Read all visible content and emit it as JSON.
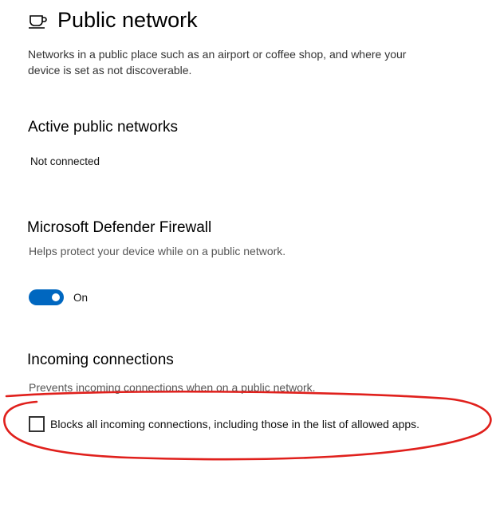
{
  "header": {
    "icon": "coffee-cup-icon",
    "title": "Public network"
  },
  "description": "Networks in a public place such as an airport or coffee shop, and where your device is set as not discoverable.",
  "active_networks": {
    "heading": "Active public networks",
    "status": "Not connected"
  },
  "firewall": {
    "heading": "Microsoft Defender Firewall",
    "description": "Helps protect your device while on a public network.",
    "toggle_state": "On",
    "toggle_on": true,
    "accent_color": "#0067c0"
  },
  "incoming": {
    "heading": "Incoming connections",
    "description": "Prevents incoming connections when on a public network.",
    "checkbox_label": "Blocks all incoming connections, including those in the list of allowed apps.",
    "checked": false
  },
  "annotation": {
    "type": "hand-drawn-red-ellipse",
    "color": "#e0201c"
  }
}
